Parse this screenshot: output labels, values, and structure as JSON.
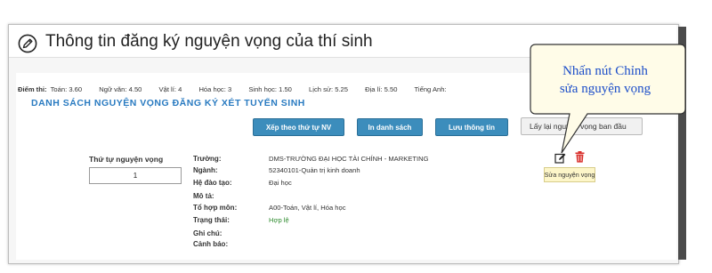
{
  "header": {
    "title": "Thông tin đăng ký nguyện vọng của thí sinh",
    "icon": "edit-circle-icon"
  },
  "scores": {
    "label": "Điểm thi:",
    "items": [
      {
        "subject": "Toán:",
        "score": "3.60"
      },
      {
        "subject": "Ngữ văn:",
        "score": "4.50"
      },
      {
        "subject": "Vật lí:",
        "score": "4"
      },
      {
        "subject": "Hóa học:",
        "score": "3"
      },
      {
        "subject": "Sinh học:",
        "score": "1.50"
      },
      {
        "subject": "Lịch sử:",
        "score": "5.25"
      },
      {
        "subject": "Địa lí:",
        "score": "5.50"
      },
      {
        "subject": "Tiếng Anh:",
        "score": ""
      }
    ]
  },
  "list_title": "DANH SÁCH NGUYỆN VỌNG ĐĂNG KÝ XÉT TUYỂN SINH",
  "buttons": {
    "sort": "Xếp theo thứ tự NV",
    "print": "In danh sách",
    "save": "Lưu thông tin",
    "reset": "Lấy lại nguyện vọng ban đầu"
  },
  "wish": {
    "order_label": "Thứ tự nguyện vọng",
    "order_value": "1",
    "fields": {
      "school_label": "Trường:",
      "school": "DMS-TRƯỜNG ĐẠI HỌC TÀI CHÍNH - MARKETING",
      "major_label": "Ngành:",
      "major": "52340101-Quản trị kinh doanh",
      "system_label": "Hệ đào tạo:",
      "system": "Đại học",
      "desc_label": "Mô tả:",
      "desc": "",
      "combo_label": "Tổ hợp môn:",
      "combo": "A00-Toán, Vật lí, Hóa học",
      "status_label": "Trạng thái:",
      "status": "Hợp lệ",
      "note_label": "Ghi chú:",
      "note": "",
      "warning_label": "Cảnh báo:",
      "warning": ""
    },
    "edit_tooltip": "Sửa nguyện vọng"
  },
  "callout": {
    "line1": "Nhấn nút Chỉnh",
    "line2": "sửa nguyện vọng"
  },
  "colors": {
    "accent_blue": "#3c8dbc",
    "title_blue": "#2a7bc1",
    "status_green": "#2e8b2e",
    "delete_red": "#d9302c",
    "callout_text": "#1c4ec9"
  }
}
